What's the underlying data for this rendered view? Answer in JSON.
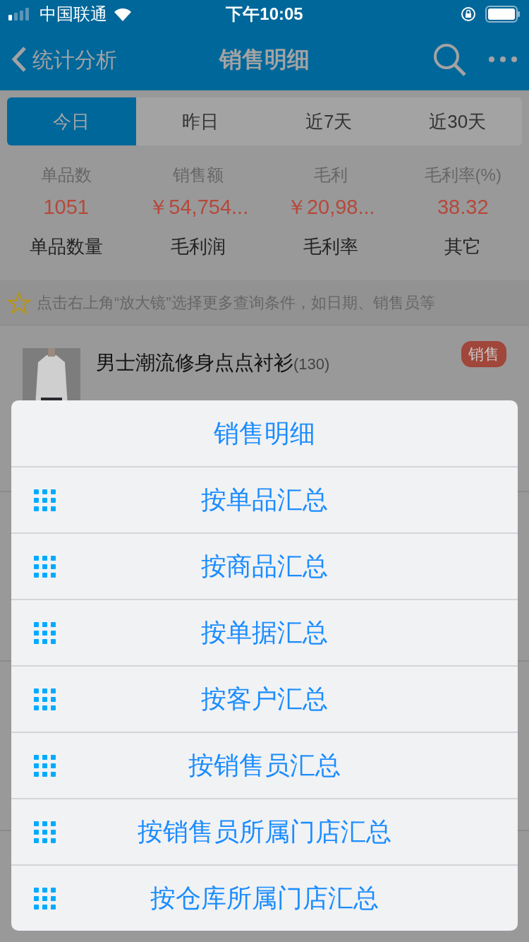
{
  "status_bar": {
    "carrier": "中国联通",
    "time": "下午10:05"
  },
  "nav": {
    "back": "统计分析",
    "title": "销售明细"
  },
  "tabs": [
    {
      "label": "今日",
      "selected": true
    },
    {
      "label": "昨日",
      "selected": false
    },
    {
      "label": "近7天",
      "selected": false
    },
    {
      "label": "近30天",
      "selected": false
    }
  ],
  "stats": [
    {
      "label": "单品数",
      "value": "1051"
    },
    {
      "label": "销售额",
      "value": "￥54,754..."
    },
    {
      "label": "毛利",
      "value": "￥20,98..."
    },
    {
      "label": "毛利率(%)",
      "value": "38.32"
    }
  ],
  "sort_options": [
    "单品数量",
    "毛利润",
    "毛利率",
    "其它"
  ],
  "hint": "点击右上角“放大镜”选择更多查询条件，如日期、销售员等",
  "product": {
    "name": "男士潮流修身点点衬衫",
    "count": "(130)",
    "badge": "销售"
  },
  "sheet": {
    "title": "销售明细",
    "items": [
      "按单品汇总",
      "按商品汇总",
      "按单据汇总",
      "按客户汇总",
      "按销售员汇总",
      "按销售员所属门店汇总",
      "按仓库所属门店汇总"
    ]
  }
}
